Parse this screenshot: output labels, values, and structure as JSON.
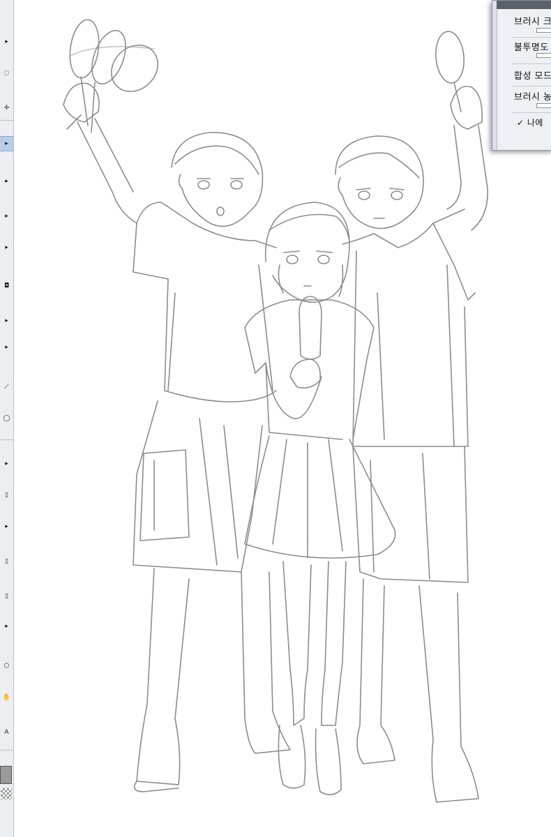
{
  "toolbar": {
    "tools": [
      {
        "name": "tool-expand-icon",
        "glyph": "▸"
      },
      {
        "name": "tool-lasso-icon",
        "glyph": "◌"
      },
      {
        "name": "tool-move-icon",
        "glyph": "✢"
      },
      {
        "name": "tool-pen-icon",
        "glyph": "▸"
      },
      {
        "name": "tool-pencil-icon",
        "glyph": "▸"
      },
      {
        "name": "tool-brush-icon",
        "glyph": "▸"
      },
      {
        "name": "tool-airbrush-icon",
        "glyph": "▸"
      },
      {
        "name": "tool-fill-icon",
        "glyph": "◘"
      },
      {
        "name": "tool-blend-icon",
        "glyph": "▸"
      },
      {
        "name": "tool-eraser-icon",
        "glyph": "▸"
      },
      {
        "name": "tool-eyedropper-icon",
        "glyph": "⟋"
      },
      {
        "name": "tool-ellipse-icon",
        "glyph": "◯"
      },
      {
        "name": "tool-gradient-icon",
        "glyph": "▸"
      },
      {
        "name": "tool-frame-icon",
        "glyph": "▯"
      },
      {
        "name": "tool-ruler-icon",
        "glyph": "▸"
      },
      {
        "name": "tool-panel-icon",
        "glyph": "▯"
      },
      {
        "name": "tool-balloon-icon",
        "glyph": "▯"
      },
      {
        "name": "tool-correct-icon",
        "glyph": "▸"
      },
      {
        "name": "tool-zoom-icon",
        "glyph": "⬡"
      },
      {
        "name": "tool-hand-icon",
        "glyph": "✋"
      },
      {
        "name": "tool-text-icon",
        "glyph": "A"
      }
    ],
    "main_color": "#9a9a9a"
  },
  "brush_panel": {
    "brush_size_label": "브러시 크",
    "opacity_label": "불투명도",
    "blend_mode_label": "합성 모드",
    "brush_density_label": "브러시 농",
    "checkbox_label": "✓ 나에"
  },
  "colors": {
    "sketch_stroke": "#8c8c8c",
    "toolbar_bg": "#eceef2",
    "panel_bg": "#eef0f3",
    "panel_title": "#5c6068"
  }
}
